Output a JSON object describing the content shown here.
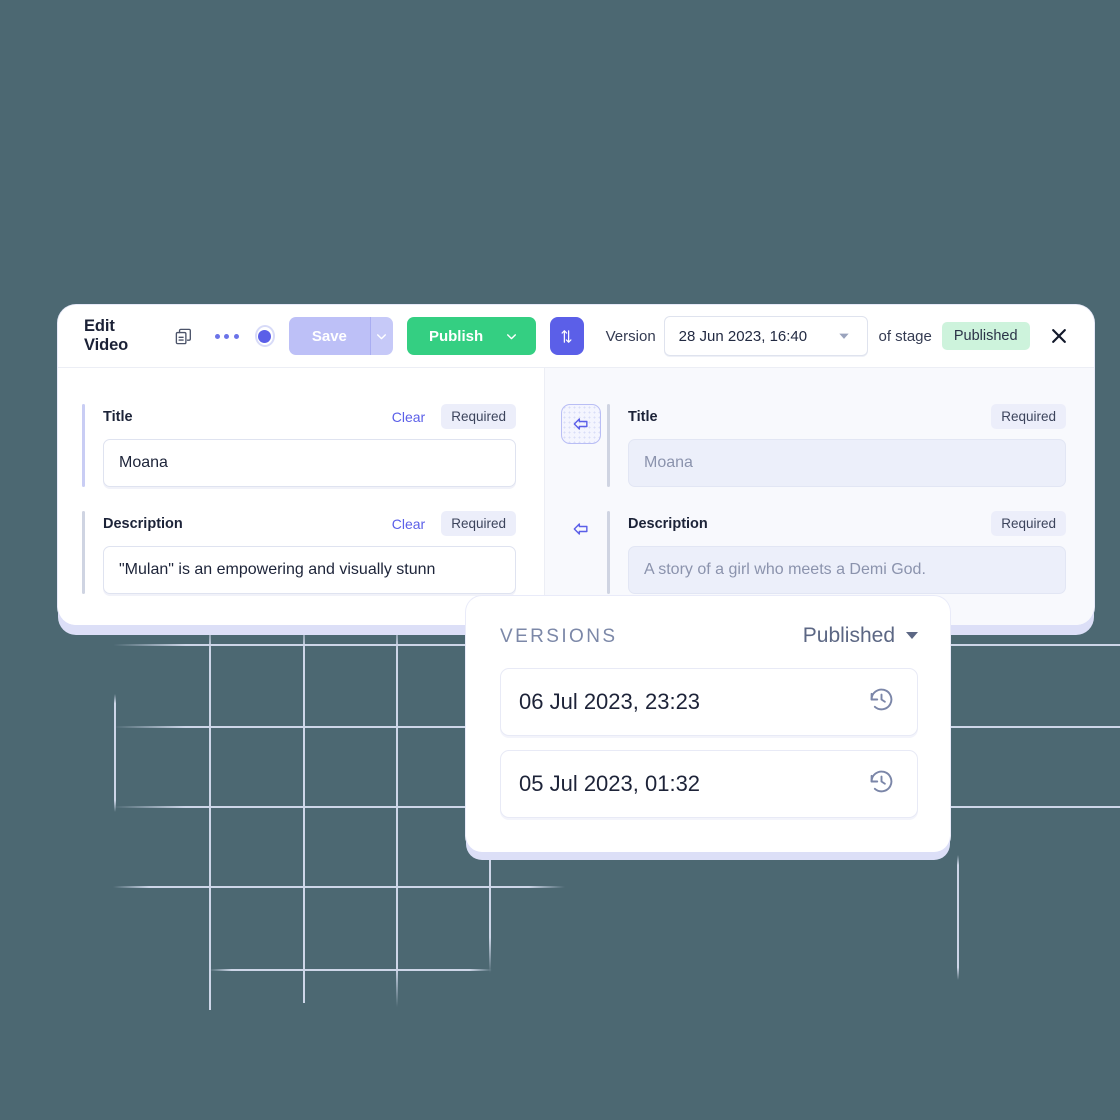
{
  "theme": {
    "background": "#4c6872",
    "accent": "#5b5fe8",
    "accent_soft": "#bdc0f7",
    "success": "#34cf82",
    "badge_green_bg": "#cdf3dc",
    "panel_bg": "#ffffff",
    "right_pane_bg": "#f8f9fd",
    "grid_line": "#cdd6e8"
  },
  "toolbar": {
    "title": "Edit Video",
    "duplicate_icon": "duplicate-icon",
    "more_icon": "more-options-icon",
    "status_radio_icon": "status-radio-icon",
    "save_label": "Save",
    "save_caret_icon": "chevron-down-icon",
    "publish_label": "Publish",
    "publish_caret_icon": "chevron-down-icon",
    "swap_icon": "compare-swap-icon",
    "version_label": "Version",
    "version_value": "28 Jun 2023, 16:40",
    "version_caret_icon": "chevron-down-icon",
    "of_stage_label": "of stage",
    "stage_badge": "Published",
    "close_icon": "close-icon"
  },
  "left_pane": {
    "fields": [
      {
        "label": "Title",
        "clear_label": "Clear",
        "required_badge": "Required",
        "value": "Moana"
      },
      {
        "label": "Description",
        "clear_label": "Clear",
        "required_badge": "Required",
        "value": "\"Mulan\" is an empowering and visually stunn"
      }
    ]
  },
  "right_pane": {
    "revert_icon": "revert-arrow-left-icon",
    "fields": [
      {
        "label": "Title",
        "required_badge": "Required",
        "value": "Moana"
      },
      {
        "label": "Description",
        "required_badge": "Required",
        "value": "A story of a girl who meets a Demi God."
      }
    ]
  },
  "versions_popover": {
    "title": "VERSIONS",
    "filter_label": "Published",
    "filter_caret_icon": "caret-down-icon",
    "restore_icon": "history-restore-icon",
    "rows": [
      {
        "timestamp": "06 Jul 2023, 23:23"
      },
      {
        "timestamp": "05 Jul 2023, 01:32"
      }
    ]
  }
}
